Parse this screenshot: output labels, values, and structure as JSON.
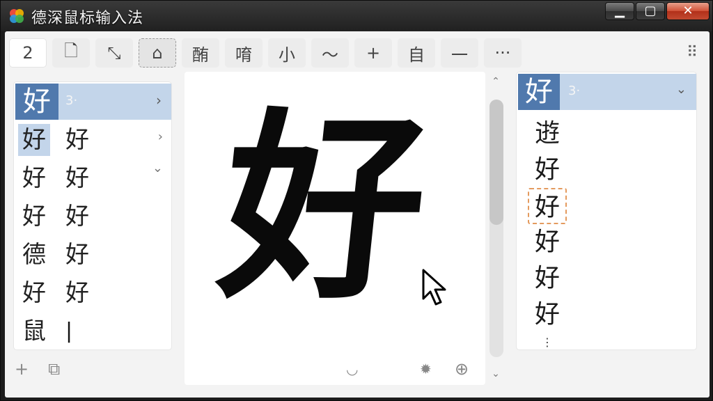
{
  "window": {
    "title": "德深鼠标输入法",
    "minimize_glyph": "▁",
    "maximize_glyph": "▢",
    "close_glyph": "✕"
  },
  "toolbar": {
    "buttons": [
      {
        "label": "2"
      },
      {
        "label": "🗋"
      },
      {
        "label": "⤡"
      },
      {
        "label": "⌂"
      },
      {
        "label": "酭"
      },
      {
        "label": "唷"
      },
      {
        "label": "小"
      },
      {
        "label": "〜"
      },
      {
        "label": "+"
      },
      {
        "label": "自"
      },
      {
        "label": "一"
      },
      {
        "label": "···"
      }
    ],
    "grid_icon": "⠿"
  },
  "left_panel": {
    "top": {
      "char": "好",
      "num": "3·",
      "chev": "›"
    },
    "rows": [
      {
        "c1": "好",
        "c2": "好",
        "chev": "›"
      },
      {
        "c1": "好",
        "c2": "好",
        "chev": "⌄"
      },
      {
        "c1": "好",
        "c2": "好",
        "chev": ""
      },
      {
        "c1": "德",
        "c2": "好",
        "chev": ""
      },
      {
        "c1": "好",
        "c2": "好",
        "chev": ""
      },
      {
        "c1": "鼠",
        "c2": "|",
        "chev": ""
      }
    ],
    "footer": {
      "add": "+",
      "copy": "⧉"
    }
  },
  "canvas": {
    "char": "好",
    "tools": {
      "undo": "◡",
      "bug": "✹",
      "add": "⊕"
    }
  },
  "scrollbar": {
    "up": "⌃",
    "down": "⌄"
  },
  "right_panel": {
    "top": {
      "char": "好",
      "num": "3·",
      "chev": "⌄"
    },
    "items": [
      "逰",
      "好",
      "好",
      "好",
      "好",
      "好"
    ],
    "more": "⋮"
  }
}
